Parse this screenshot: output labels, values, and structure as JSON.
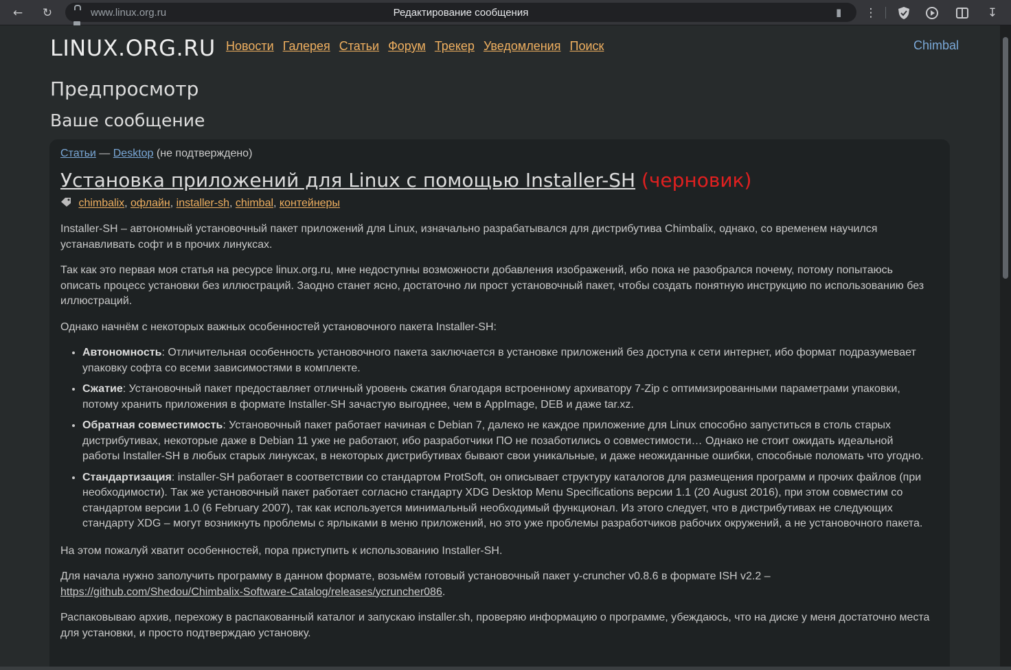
{
  "browser": {
    "url": "www.linux.org.ru",
    "tab_title": "Редактирование сообщения"
  },
  "site": {
    "title": "LINUX.ORG.RU",
    "nav": [
      "Новости",
      "Галерея",
      "Статьи",
      "Форум",
      "Трекер",
      "Уведомления",
      "Поиск"
    ],
    "user": "Chimbal"
  },
  "page": {
    "preview_heading": "Предпросмотр",
    "message_heading": "Ваше сообщение"
  },
  "post": {
    "breadcrumb": {
      "section": "Статьи",
      "sep": " — ",
      "group": "Desktop",
      "status": " (не подтверждено)"
    },
    "title": "Установка приложений для Linux с помощью Installer-SH",
    "draft_label": "(черновик)",
    "tags": [
      "chimbalix",
      "офлайн",
      "installer-sh",
      "chimbal",
      "контейнеры"
    ],
    "paragraphs_intro": [
      "Installer-SH – автономный установочный пакет приложений для Linux, изначально разрабатывался для дистрибутива Chimbalix, однако, со временем научился устанавливать софт и в прочих линуксах.",
      "Так как это первая моя статья на ресурсе linux.org.ru, мне недоступны возможности добавления изображений, ибо пока не разобрался почему, потому попытаюсь описать процесс установки без иллюстраций. Заодно станет ясно, достаточно ли прост установочный пакет, чтобы создать понятную инструкцию по использованию без иллюстраций.",
      "Однако начнём с некоторых важных особенностей установочного пакета Installer-SH:"
    ],
    "features": [
      {
        "name": "Автономность",
        "text": ": Отличительная особенность установочного пакета заключается в установке приложений без доступа к сети интернет, ибо формат подразумевает упаковку софта со всеми зависимостями в комплекте."
      },
      {
        "name": "Сжатие",
        "text": ": Установочный пакет предоставляет отличный уровень сжатия благодаря встроенному архиватору 7-Zip с оптимизированными параметрами упаковки, потому хранить приложения в формате Installer-SH зачастую выгоднее, чем в AppImage, DEB и даже tar.xz."
      },
      {
        "name": "Обратная совместимость",
        "text": ": Установочный пакет работает начиная с Debian 7, далеко не каждое приложение для Linux способно запуститься в столь старых дистрибутивах, некоторые даже в Debian 11 уже не работают, ибо разработчики ПО не позаботились о совместимости… Однако не стоит ожидать идеальной работы Installer-SH в любых старых линуксах, в некоторых дистрибутивах бывают свои уникальные, и даже неожиданные ошибки, способные поломать что угодно."
      },
      {
        "name": "Стандартизация",
        "text": ": installer-SH работает в соответствии со стандартом ProtSoft, он описывает структуру каталогов для размещения программ и прочих файлов (при необходимости). Так же установочный пакет работает согласно стандарту XDG Desktop Menu Specifications версии 1.1 (20 August 2016), при этом совместим со стандартом версии 1.0 (6 February 2007), так как используется минимальный необходимый функционал. Из этого следует, что в дистрибутивах не следующих стандарту XDG – могут возникнуть проблемы с ярлыками в меню приложений, но это уже проблемы разработчиков рабочих окружений, а не установочного пакета."
      }
    ],
    "p_after_list": "На этом пожалуй хватит особенностей, пора приступить к использованию Installer-SH.",
    "p_download": "Для начала нужно заполучить программу в данном формате, возьмём готовый установочный пакет y-cruncher v0.8.6 в формате ISH v2.2 –",
    "download_link": "https://github.com/Shedou/Chimbalix-Software-Catalog/releases/ycruncher086",
    "download_end": ".",
    "p_unpack": "Распаковываю архив, перехожу в распакованный каталог и запускаю installer.sh, проверяю информацию о программе, убеждаюсь, что на диске у меня достаточно места для установки, и просто подтверждаю установку."
  }
}
